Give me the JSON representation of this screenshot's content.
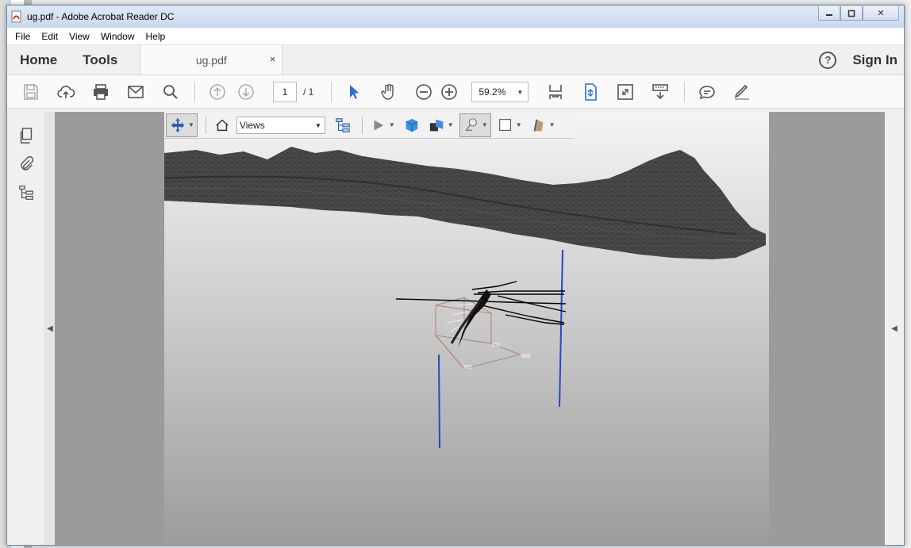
{
  "window": {
    "title": "ug.pdf - Adobe Acrobat Reader DC",
    "minimize_label": "",
    "restore_label": "",
    "close_label": "✕"
  },
  "menu": {
    "items": [
      "File",
      "Edit",
      "View",
      "Window",
      "Help"
    ]
  },
  "tabs": {
    "home": "Home",
    "tools": "Tools",
    "document": "ug.pdf",
    "document_close": "×",
    "help": "?",
    "sign_in": "Sign In"
  },
  "toolbar": {
    "page_current": "1",
    "page_total": "/ 1",
    "zoom": "59.2%"
  },
  "toolbar3d": {
    "views_label": "Views"
  },
  "scene": {
    "terrain_color": "#3a3a3a",
    "borehole_color": "#2a45c8",
    "box_color": "#b08070",
    "box_labels": [
      "200",
      "500",
      "300"
    ]
  }
}
